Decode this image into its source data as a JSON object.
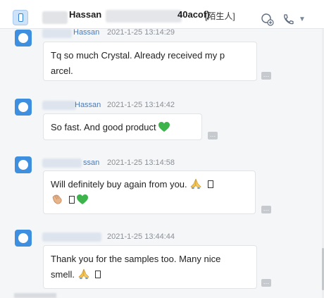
{
  "header": {
    "name": "Hassan",
    "id_suffix": "40acof)",
    "tag": "[陌生人]",
    "icons": [
      "phone-device-icon",
      "add-contact-icon",
      "call-icon",
      "chevron-down-icon"
    ]
  },
  "messages": [
    {
      "sender": "Hassan",
      "time": "2021-1-25 13:14:29",
      "lines": [
        "Tq so much Crystal. Already received my p",
        "arcel."
      ]
    },
    {
      "sender": "Hassan",
      "time": "2021-1-25 13:14:42",
      "lines": [
        "So fast. And good product"
      ],
      "trailing": [
        "green-heart-emoji"
      ]
    },
    {
      "sender": "ssan",
      "time": "2021-1-25 13:14:58",
      "lines": [
        "Will definitely buy again from you."
      ],
      "trailing": [
        "praying-hands-emoji",
        "missing-glyph",
        "clapping-hands-emoji",
        "missing-glyph",
        "green-heart-emoji"
      ]
    },
    {
      "sender": "",
      "time": "2021-1-25 13:44:44",
      "lines": [
        "Thank you for the samples too. Many nice",
        "smell."
      ],
      "trailing": [
        "praying-hands-emoji",
        "missing-glyph"
      ]
    }
  ],
  "colors": {
    "accent": "#2f7fd3",
    "avatar": "#3e8fe0",
    "sender": "#4a79b9",
    "heart": "#3cb44b"
  }
}
